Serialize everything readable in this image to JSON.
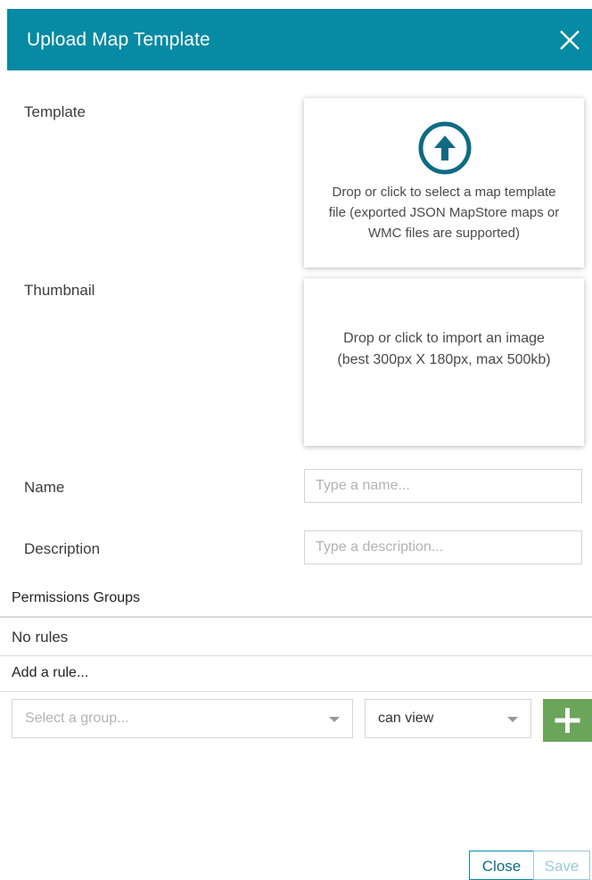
{
  "header": {
    "title": "Upload Map Template",
    "close_icon": "close-icon",
    "background_color": "#078aa3"
  },
  "template": {
    "label": "Template",
    "icon": "upload-arrow-icon",
    "dropzone_lines": [
      "Drop or click to select a map template",
      "file (exported JSON MapStore maps or",
      "WMC files are supported)"
    ]
  },
  "thumbnail": {
    "label": "Thumbnail",
    "dropzone_lines": [
      "Drop or click to import an image",
      "(best 300px X 180px, max 500kb)"
    ]
  },
  "name": {
    "label": "Name",
    "placeholder": "Type a name...",
    "value": ""
  },
  "description": {
    "label": "Description",
    "placeholder": "Type a description...",
    "value": ""
  },
  "permissions": {
    "title": "Permissions Groups",
    "empty_text": "No rules",
    "add_rule_title": "Add a rule...",
    "group_select": {
      "placeholder": "Select a group...",
      "icon": "chevron-down-icon"
    },
    "permission_select": {
      "selected": "can view",
      "icon": "chevron-down-icon"
    },
    "add_button": {
      "icon": "plus-icon",
      "color": "#6aa55a"
    }
  },
  "footer": {
    "close_label": "Close",
    "save_label": "Save",
    "accent_color": "#078aa3"
  }
}
